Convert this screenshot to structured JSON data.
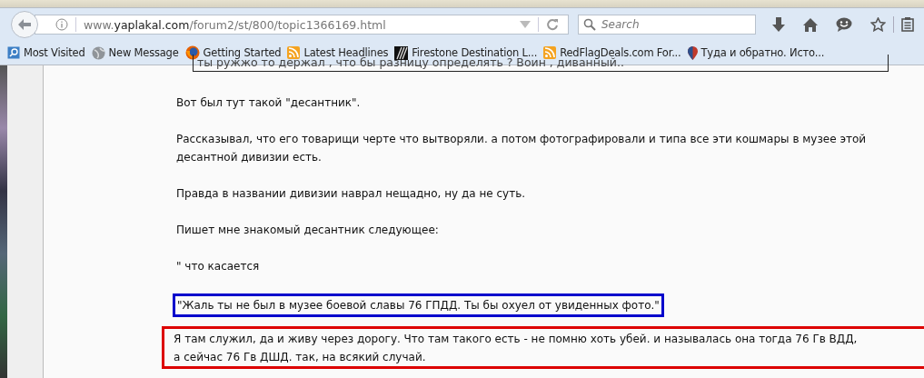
{
  "toolbar": {
    "url_host_prefix": "www.",
    "url_host": "yaplakal.com",
    "url_path": "/forum2/st/800/topic1366169.html",
    "search": {
      "placeholder": "Search"
    }
  },
  "bookmarks": [
    {
      "label": "Most Visited",
      "kind": "search"
    },
    {
      "label": "New Message",
      "kind": "globe"
    },
    {
      "label": "Getting Started",
      "kind": "firefox"
    },
    {
      "label": "Latest Headlines",
      "kind": "rss"
    },
    {
      "label": "Firestone Destination L...",
      "kind": "tire"
    },
    {
      "label": "RedFlagDeals.com For...",
      "kind": "rss"
    },
    {
      "label": "Туда и обратно. Исто...",
      "kind": "pin"
    }
  ],
  "post": [
    {
      "kind": "quote",
      "lines": [
        "ты ружжо то держал , что бы разницу определять ? Воин , диванный.."
      ]
    },
    {
      "kind": "text",
      "lines": [
        "Вот был тут такой \"десантник\"."
      ]
    },
    {
      "kind": "text",
      "lines": [
        "Рассказывал, что его товарищи черте что вытворяли. а потом фотографировали и типа все эти кошмары в музее этой",
        "десантной дивизии есть."
      ]
    },
    {
      "kind": "text",
      "lines": [
        "Правда в названии дивизии наврал нещадно, ну да не суть."
      ]
    },
    {
      "kind": "text",
      "lines": [
        "Пишет мне знакомый десантник следующее:"
      ]
    },
    {
      "kind": "text",
      "lines": [
        "\" что касается"
      ]
    },
    {
      "kind": "blue_box",
      "lines": [
        "\"Жаль ты не был в музее боевой славы 76 ГПДД. Ты бы охуел от увиденных фото.\""
      ]
    },
    {
      "kind": "red_box",
      "lines": [
        "Я там служил, да и живу через дорогу. Что там такого есть - не помню хоть убей. и называлась она тогда 76 Гв ВДД,",
        "а сейчас 76 Гв ДШД. так, на всякий случай."
      ]
    }
  ]
}
